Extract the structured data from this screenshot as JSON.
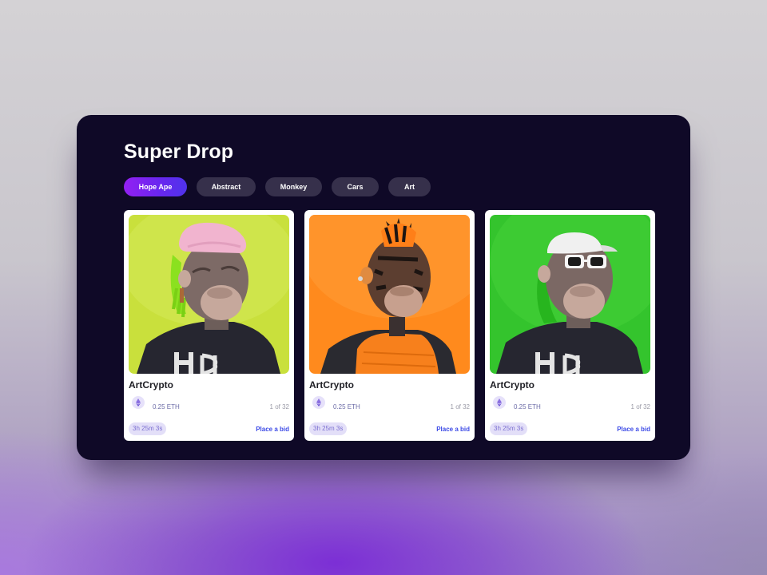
{
  "page": {
    "title": "Super Drop"
  },
  "filters": [
    {
      "label": "Hope Ape",
      "active": true
    },
    {
      "label": "Abstract",
      "active": false
    },
    {
      "label": "Monkey",
      "active": false
    },
    {
      "label": "Cars",
      "active": false
    },
    {
      "label": "Art",
      "active": false
    }
  ],
  "cards": [
    {
      "title": "ArtCrypto",
      "price": "0.25 ETH",
      "edition": "1 of 32",
      "time_left": "3h 25m 3s",
      "bid_label": "Place a bid",
      "art_background": "#c9e03c",
      "art_subject": "ape-pink-cap-green-hair"
    },
    {
      "title": "ArtCrypto",
      "price": "0.25 ETH",
      "edition": "1 of 32",
      "time_left": "3h 25m 3s",
      "bid_label": "Place a bid",
      "art_background": "#ff8a1d",
      "art_subject": "ape-tiger-orange-vest"
    },
    {
      "title": "ArtCrypto",
      "price": "0.25 ETH",
      "edition": "1 of 32",
      "time_left": "3h 25m 3s",
      "bid_label": "Place a bid",
      "art_background": "#34c42d",
      "art_subject": "ape-white-cap-sunglasses"
    }
  ],
  "icons": {
    "price_icon": "ethereum-icon"
  },
  "colors": {
    "panel_background": "#0f0927",
    "chip_active_start": "#9320f2",
    "chip_active_end": "#4f33ea",
    "chip_inactive": "#36304b",
    "bid_link": "#3d4be6",
    "timer_badge": "#e3dff8"
  }
}
